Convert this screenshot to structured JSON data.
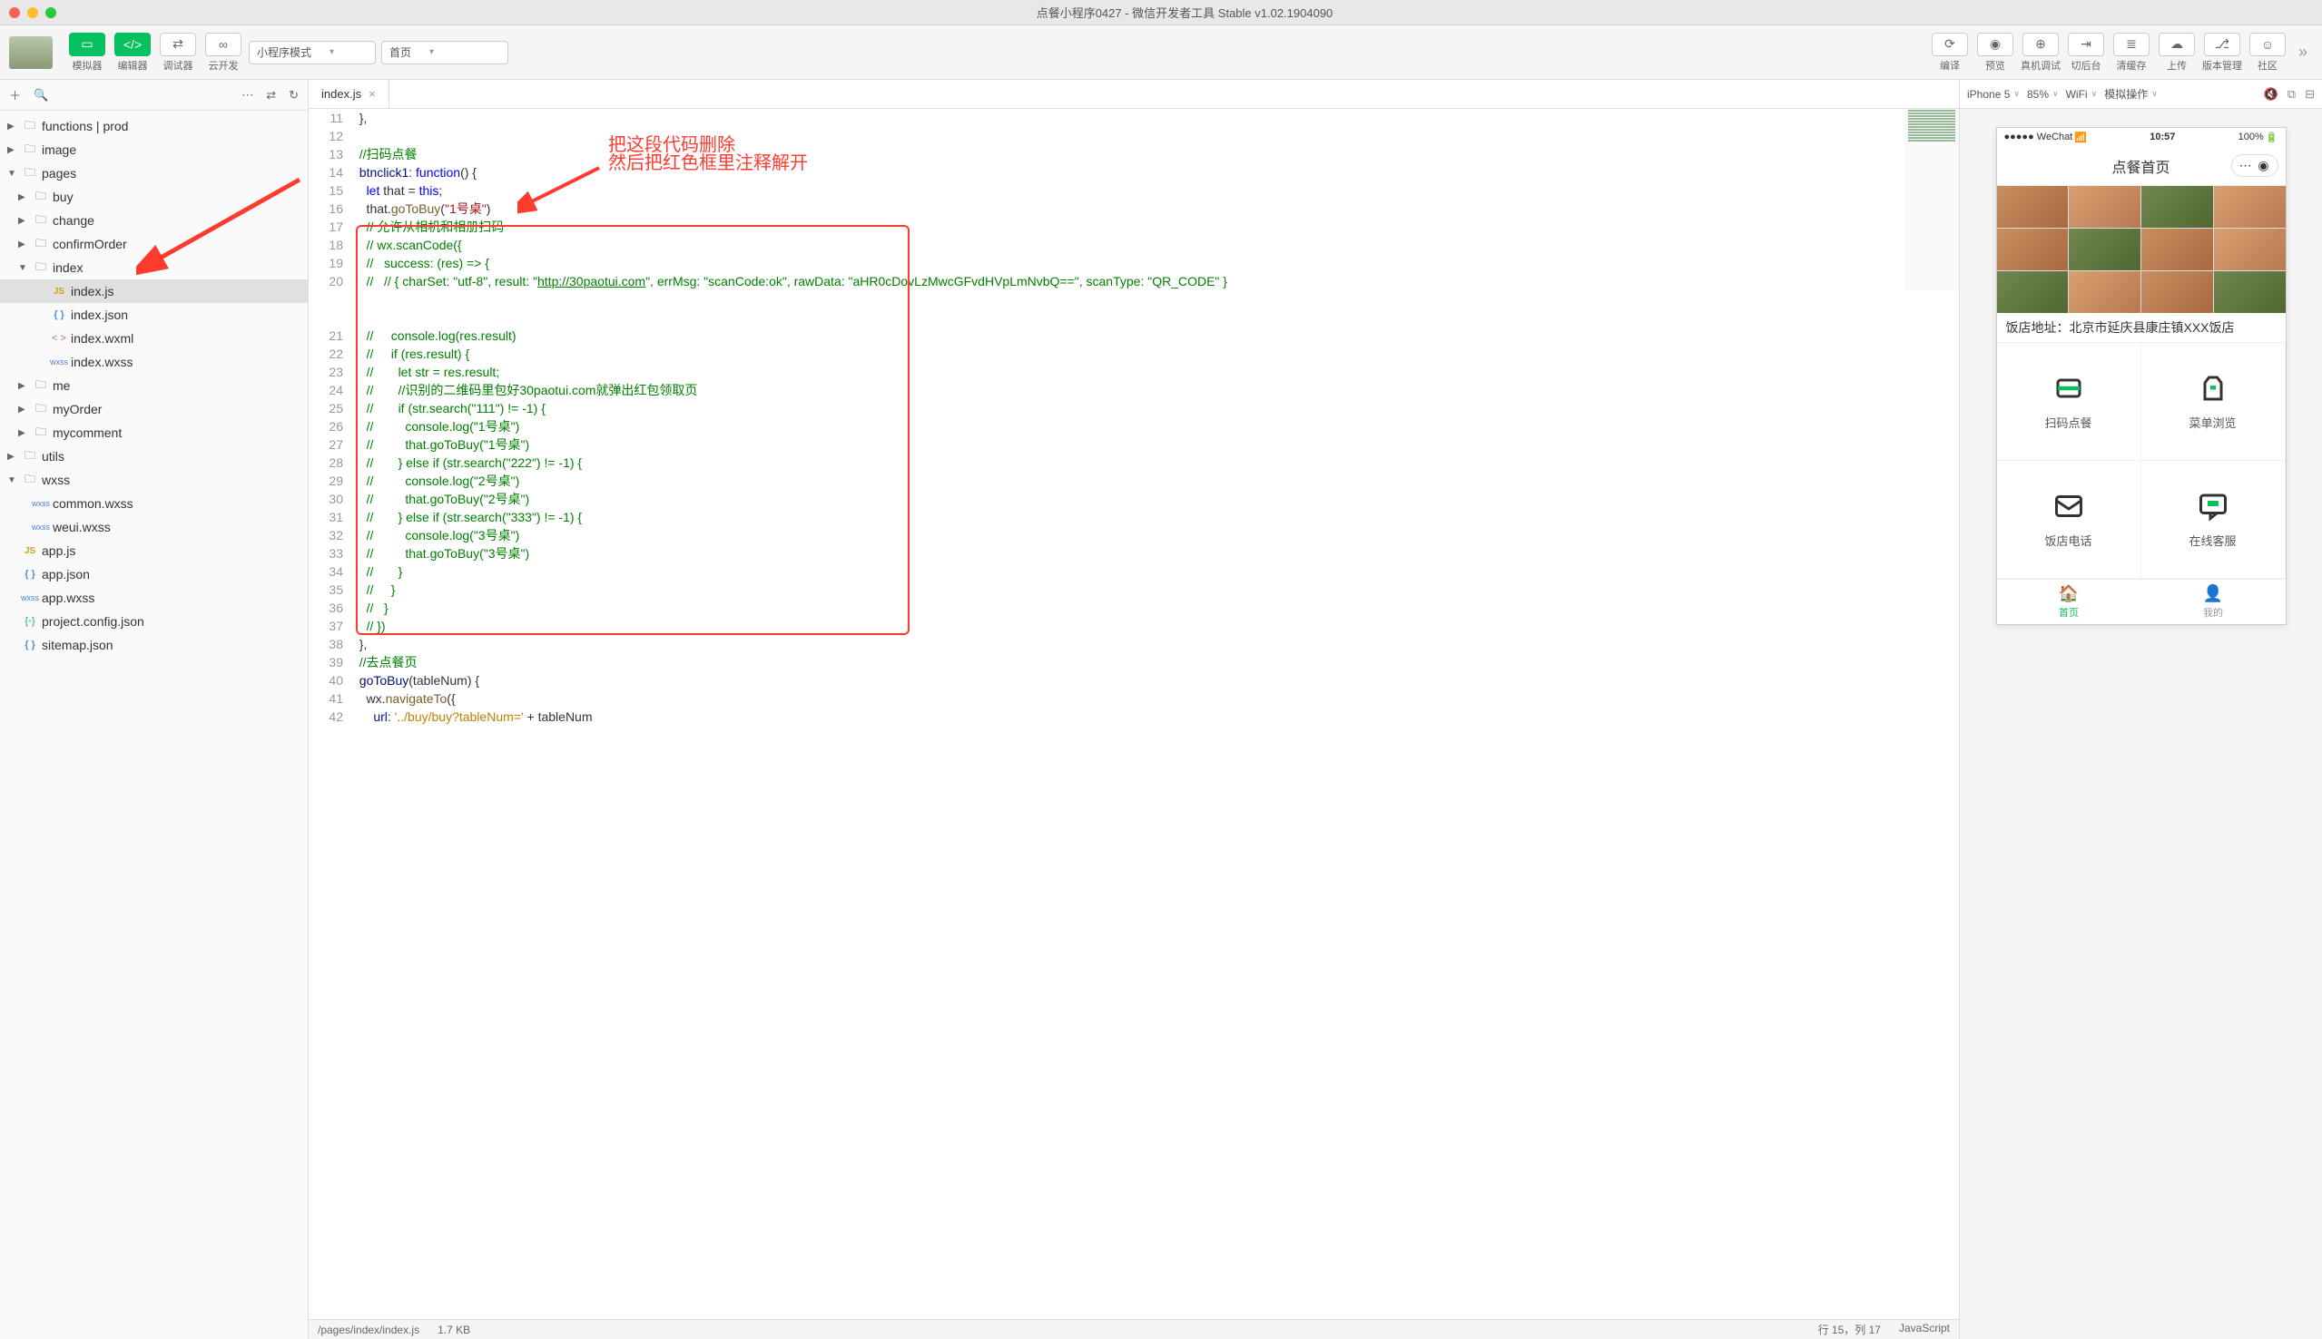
{
  "window": {
    "title": "点餐小程序0427 - 微信开发者工具 Stable v1.02.1904090"
  },
  "toolbar": {
    "simulator": "模拟器",
    "editor": "编辑器",
    "debugger": "调试器",
    "cloud": "云开发",
    "mode": "小程序模式",
    "page": "首页",
    "compile": "编译",
    "preview": "预览",
    "remote": "真机调试",
    "background": "切后台",
    "cache": "清缓存",
    "upload": "上传",
    "version": "版本管理",
    "community": "社区"
  },
  "tree": [
    {
      "d": 0,
      "t": "folder",
      "chev": "▶",
      "ico": "📁",
      "label": "functions | prod"
    },
    {
      "d": 0,
      "t": "folder",
      "chev": "▶",
      "ico": "📁",
      "label": "image"
    },
    {
      "d": 0,
      "t": "folder",
      "chev": "▼",
      "ico": "📁",
      "label": "pages"
    },
    {
      "d": 1,
      "t": "folder",
      "chev": "▶",
      "ico": "📁",
      "label": "buy"
    },
    {
      "d": 1,
      "t": "folder",
      "chev": "▶",
      "ico": "📁",
      "label": "change"
    },
    {
      "d": 1,
      "t": "folder",
      "chev": "▶",
      "ico": "📁",
      "label": "confirmOrder"
    },
    {
      "d": 1,
      "t": "folder",
      "chev": "▼",
      "ico": "📁",
      "label": "index"
    },
    {
      "d": 2,
      "t": "js",
      "label": "index.js",
      "sel": true
    },
    {
      "d": 2,
      "t": "json",
      "label": "index.json"
    },
    {
      "d": 2,
      "t": "wxml",
      "label": "index.wxml"
    },
    {
      "d": 2,
      "t": "wxss",
      "label": "index.wxss"
    },
    {
      "d": 1,
      "t": "folder",
      "chev": "▶",
      "ico": "📁",
      "label": "me"
    },
    {
      "d": 1,
      "t": "folder",
      "chev": "▶",
      "ico": "📁",
      "label": "myOrder"
    },
    {
      "d": 1,
      "t": "folder",
      "chev": "▶",
      "ico": "📁",
      "label": "mycomment"
    },
    {
      "d": 0,
      "t": "folder",
      "chev": "▶",
      "ico": "📁",
      "label": "utils"
    },
    {
      "d": 0,
      "t": "folder",
      "chev": "▼",
      "ico": "📁",
      "label": "wxss"
    },
    {
      "d": 1,
      "t": "wxss",
      "label": "common.wxss"
    },
    {
      "d": 1,
      "t": "wxss",
      "label": "weui.wxss"
    },
    {
      "d": 0,
      "t": "js",
      "label": "app.js"
    },
    {
      "d": 0,
      "t": "json",
      "label": "app.json"
    },
    {
      "d": 0,
      "t": "wxss",
      "label": "app.wxss"
    },
    {
      "d": 0,
      "t": "pj",
      "label": "project.config.json"
    },
    {
      "d": 0,
      "t": "json",
      "label": "sitemap.json"
    }
  ],
  "tab": {
    "name": "index.js"
  },
  "annotations": {
    "line1": "把这段代码删除",
    "line2": "然后把红色框里注释解开"
  },
  "code": {
    "start": 11,
    "lines": [
      {
        "n": 11,
        "html": "  },"
      },
      {
        "n": 12,
        "html": ""
      },
      {
        "n": 13,
        "html": "  <span class='c-com'>//扫码点餐</span>"
      },
      {
        "n": 14,
        "html": "  <span class='c-prop'>btnclick1</span>: <span class='c-kw'>function</span>() {"
      },
      {
        "n": 15,
        "html": "    <span class='c-kw'>let</span> that = <span class='c-this'>this</span>;"
      },
      {
        "n": 16,
        "html": "    that.<span class='c-fn'>goToBuy</span>(<span class='c-str'>\"1号桌\"</span>)"
      },
      {
        "n": 17,
        "html": "    <span class='c-com'>// 允许从相机和相册扫码</span>"
      },
      {
        "n": 18,
        "html": "    <span class='c-com'>// wx.scanCode({</span>"
      },
      {
        "n": 19,
        "html": "    <span class='c-com'>//   success: (res) =&gt; {</span>"
      },
      {
        "n": 20,
        "html": "    <span class='c-com'>//   // { charSet: \"utf-8\", result: \"<u>http://30paotui.com</u>\", errMsg: \"scanCode:ok\", rawData: \"aHR0cDovLzMwcGFvdHVpLmNvbQ==\", scanType: \"QR_CODE\" }</span>",
        "wrap": true
      },
      {
        "n": 21,
        "html": "    <span class='c-com'>//     console.log(res.result)</span>"
      },
      {
        "n": 22,
        "html": "    <span class='c-com'>//     if (res.result) {</span>"
      },
      {
        "n": 23,
        "html": "    <span class='c-com'>//       let str = res.result;</span>"
      },
      {
        "n": 24,
        "html": "    <span class='c-com'>//       //识别的二维码里包好30paotui.com就弹出红包领取页</span>"
      },
      {
        "n": 25,
        "html": "    <span class='c-com'>//       if (str.search(\"111\") != -1) {</span>"
      },
      {
        "n": 26,
        "html": "    <span class='c-com'>//         console.log(\"1号桌\")</span>"
      },
      {
        "n": 27,
        "html": "    <span class='c-com'>//         that.goToBuy(\"1号桌\")</span>"
      },
      {
        "n": 28,
        "html": "    <span class='c-com'>//       } else if (str.search(\"222\") != -1) {</span>"
      },
      {
        "n": 29,
        "html": "    <span class='c-com'>//         console.log(\"2号桌\")</span>"
      },
      {
        "n": 30,
        "html": "    <span class='c-com'>//         that.goToBuy(\"2号桌\")</span>"
      },
      {
        "n": 31,
        "html": "    <span class='c-com'>//       } else if (str.search(\"333\") != -1) {</span>"
      },
      {
        "n": 32,
        "html": "    <span class='c-com'>//         console.log(\"3号桌\")</span>"
      },
      {
        "n": 33,
        "html": "    <span class='c-com'>//         that.goToBuy(\"3号桌\")</span>"
      },
      {
        "n": 34,
        "html": "    <span class='c-com'>//       }</span>"
      },
      {
        "n": 35,
        "html": "    <span class='c-com'>//     }</span>"
      },
      {
        "n": 36,
        "html": "    <span class='c-com'>//   }</span>"
      },
      {
        "n": 37,
        "html": "    <span class='c-com'>// })</span>"
      },
      {
        "n": 38,
        "html": "  },"
      },
      {
        "n": 39,
        "html": "  <span class='c-com'>//去点餐页</span>"
      },
      {
        "n": 40,
        "html": "  <span class='c-prop'>goToBuy</span>(tableNum) {"
      },
      {
        "n": 41,
        "html": "    wx.<span class='c-fn'>navigateTo</span>({"
      },
      {
        "n": 42,
        "html": "      <span class='c-prop'>url</span>: <span class='c-str2'>'../buy/buy?tableNum='</span> + tableNum"
      }
    ]
  },
  "status": {
    "path": "/pages/index/index.js",
    "size": "1.7 KB",
    "pos": "行 15，列 17",
    "lang": "JavaScript"
  },
  "sim": {
    "device": "iPhone 5",
    "zoom": "85%",
    "net": "WiFi",
    "action": "模拟操作",
    "signal": "●●●●● WeChat",
    "time": "10:57",
    "battery": "100%",
    "title": "点餐首页",
    "address": "饭店地址：北京市延庆县康庄镇XXX饭店",
    "cells": [
      "扫码点餐",
      "菜单浏览",
      "饭店电话",
      "在线客服"
    ],
    "tabs": [
      "首页",
      "我的"
    ]
  }
}
